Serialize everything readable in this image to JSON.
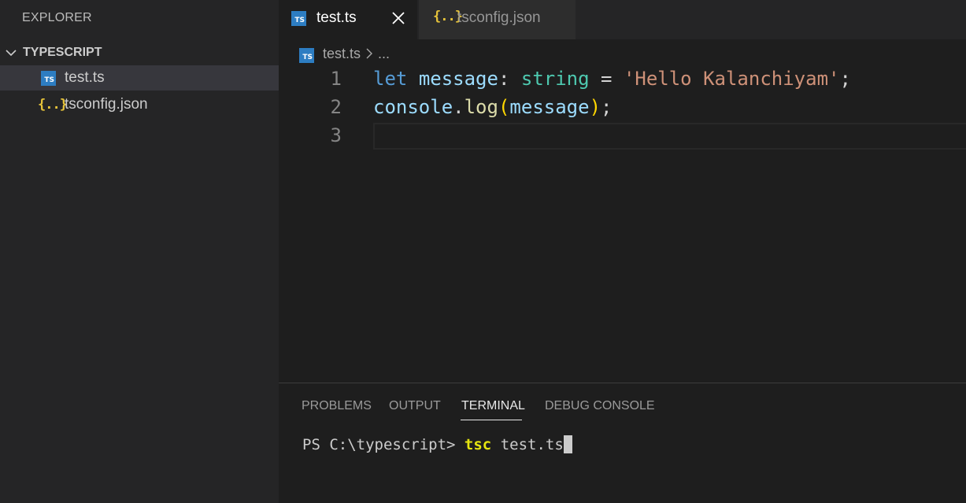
{
  "sidebar": {
    "title": "EXPLORER",
    "section": "TYPESCRIPT",
    "files": [
      {
        "name": "test.ts",
        "icon": "ts-file-icon",
        "active": true
      },
      {
        "name": "tsconfig.json",
        "icon": "json-file-icon",
        "active": false
      }
    ]
  },
  "tabs": [
    {
      "label": "test.ts",
      "icon": "ts-file-icon",
      "active": true
    },
    {
      "label": "tsconfig.json",
      "icon": "json-file-icon",
      "active": false
    }
  ],
  "icon_text": {
    "ts": "TS",
    "json": "{..}"
  },
  "breadcrumb": {
    "file": "test.ts",
    "more": "..."
  },
  "editor": {
    "line_numbers": [
      "1",
      "2",
      "3"
    ],
    "line1": {
      "kw": "let",
      "var": "message",
      "colon": ":",
      "type": "string",
      "eq": "=",
      "str": "'Hello Kalanchiyam'",
      "semi": ";"
    },
    "line2": {
      "obj": "console",
      "dot": ".",
      "fn": "log",
      "open": "(",
      "arg": "message",
      "close": ")",
      "semi": ";"
    }
  },
  "panel": {
    "tabs": [
      "PROBLEMS",
      "OUTPUT",
      "TERMINAL",
      "DEBUG CONSOLE"
    ],
    "active_tab": "TERMINAL",
    "terminal": {
      "prompt": "PS C:\\typescript>",
      "command": "tsc",
      "args": "test.ts"
    }
  },
  "colors": {
    "accent": "#2d7dc2",
    "json": "#e6c33a",
    "background": "#1e1e1e",
    "sidebar": "#252526"
  }
}
